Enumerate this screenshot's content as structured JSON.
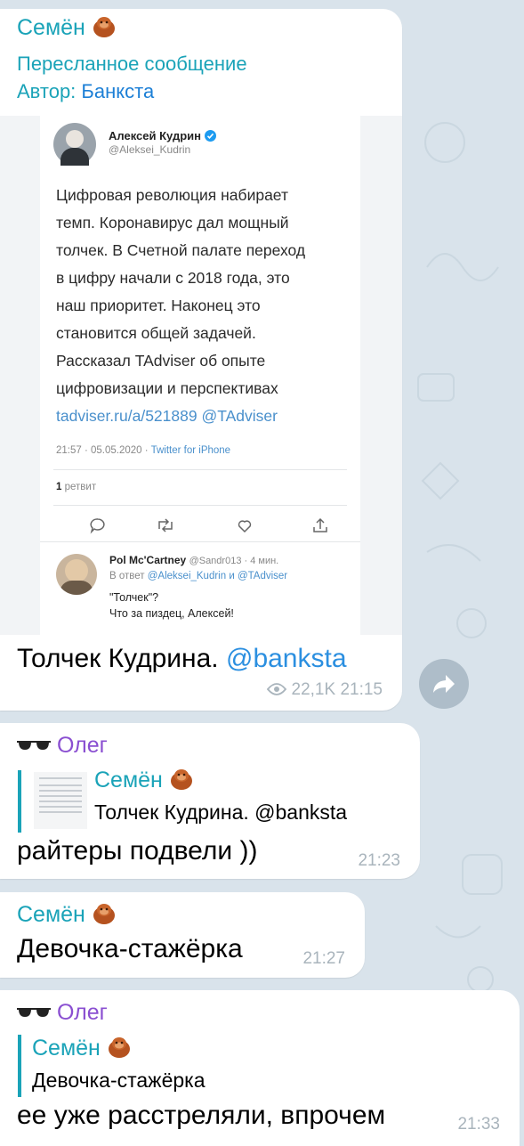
{
  "colors": {
    "background": "#d9e3eb",
    "bubble": "#ffffff",
    "semyon_name": "#1aa3b8",
    "oleg_name": "#8a4fd1",
    "link": "#2b8fe0",
    "time": "#a9b4bc"
  },
  "messages": [
    {
      "sender": "Семён",
      "sender_icon": "orangutan-emoji",
      "forwarded_label": "Пересланное сообщение",
      "author_prefix": "Автор:",
      "author": "Банкста",
      "tweet": {
        "name": "Алексей Кудрин",
        "handle": "@Aleksei_Kudrin",
        "verified": true,
        "body_lines": [
          "Цифровая революция набирает",
          "темп. Коронавирус дал мощный",
          "толчек. В Счетной  палате переход",
          "в цифру начали с 2018 года, это",
          "наш  приоритет. Наконец это",
          "становится общей задачей.",
          "Рассказал TAdviser об опыте",
          "цифровизации и перспективах"
        ],
        "link_line": "tadviser.ru/a/521889 @TAdviser",
        "meta_time": "21:57 · 05.05.2020 ·",
        "meta_client": "Twitter for iPhone",
        "retweets_count": "1",
        "retweets_label": "ретвит",
        "reply": {
          "name": "Pol Mc'Cartney",
          "handle_time": "@Sandr013 · 4 мин.",
          "in_reply_prefix": "В ответ",
          "in_reply_to": "@Aleksei_Kudrin и @TAdviser",
          "line1": "\"Толчек\"?",
          "line2": "Что за пиздец, Алексей!"
        }
      },
      "text": "Толчек Кудрина.",
      "text_link": "@banksta",
      "views": "22,1K",
      "time": "21:15"
    },
    {
      "sender_icon": "sunglasses-emoji",
      "sender": "Олег",
      "reply_to_name": "Семён",
      "reply_to_text": "Толчек Кудрина. @banksta",
      "text": "райтеры подвели ))",
      "time": "21:23"
    },
    {
      "sender": "Семён",
      "text": "Девочка-стажёрка",
      "time": "21:27"
    },
    {
      "sender": "Олег",
      "reply_to_name": "Семён",
      "reply_to_text": "Девочка-стажёрка",
      "text": "ее уже расстреляли, впрочем",
      "time": "21:33"
    }
  ]
}
